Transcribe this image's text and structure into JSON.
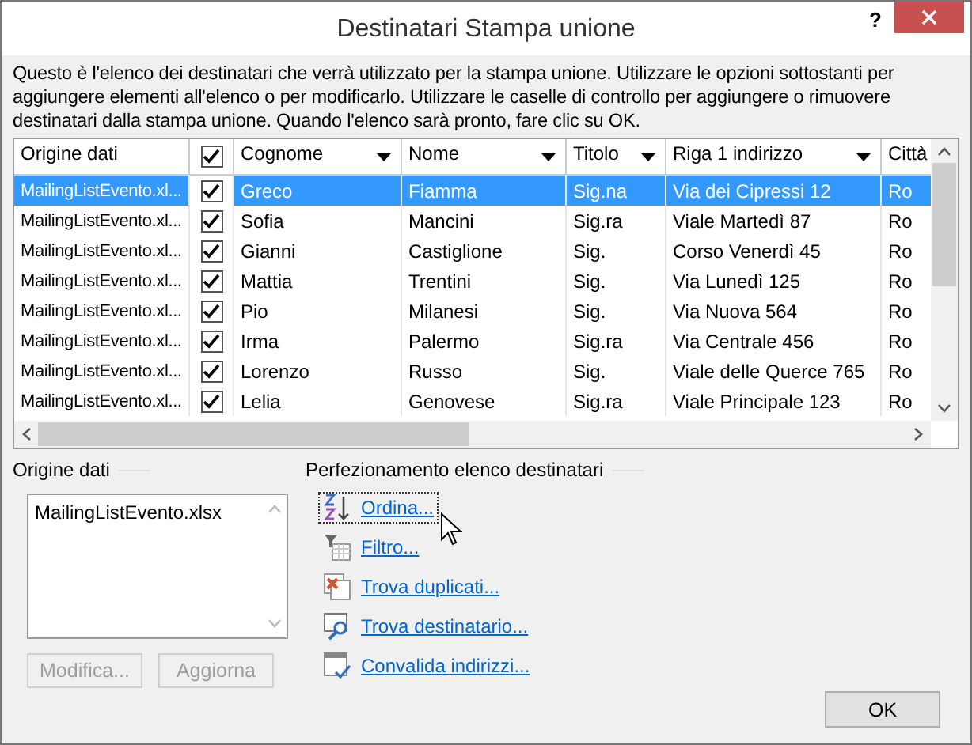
{
  "window": {
    "title": "Destinatari Stampa unione",
    "help": "?"
  },
  "description": "Questo è l'elenco dei destinatari che verrà utilizzato per la stampa unione. Utilizzare le opzioni sottostanti per aggiungere elementi all'elenco o per modificarlo. Utilizzare le caselle di controllo per aggiungere o rimuovere destinatari dalla stampa unione. Quando l'elenco sarà pronto, fare clic su OK.",
  "table": {
    "header_checked": true,
    "columns": [
      {
        "label": "Origine dati",
        "kind": "text"
      },
      {
        "label": "Cognome",
        "kind": "dropdown"
      },
      {
        "label": "Nome",
        "kind": "dropdown"
      },
      {
        "label": "Titolo",
        "kind": "dropdown"
      },
      {
        "label": "Riga 1 indirizzo",
        "kind": "dropdown"
      },
      {
        "label": "Città",
        "kind": "text"
      }
    ],
    "rows": [
      {
        "selected": true,
        "checked": true,
        "cells": [
          "MailingListEvento.xl...",
          "Greco",
          "Fiamma",
          "Sig.na",
          "Via dei Cipressi 12",
          "Ro"
        ]
      },
      {
        "selected": false,
        "checked": true,
        "cells": [
          "MailingListEvento.xl...",
          "Sofia",
          "Mancini",
          "Sig.ra",
          "Viale Martedì 87",
          "Ro"
        ]
      },
      {
        "selected": false,
        "checked": true,
        "cells": [
          "MailingListEvento.xl...",
          "Gianni",
          "Castiglione",
          "Sig.",
          "Corso Venerdì 45",
          "Ro"
        ]
      },
      {
        "selected": false,
        "checked": true,
        "cells": [
          "MailingListEvento.xl...",
          "Mattia",
          "Trentini",
          "Sig.",
          "Via Lunedì 125",
          "Ro"
        ]
      },
      {
        "selected": false,
        "checked": true,
        "cells": [
          "MailingListEvento.xl...",
          "Pio",
          "Milanesi",
          "Sig.",
          "Via Nuova 564",
          "Ro"
        ]
      },
      {
        "selected": false,
        "checked": true,
        "cells": [
          "MailingListEvento.xl...",
          "Irma",
          "Palermo",
          "Sig.ra",
          "Via Centrale 456",
          "Ro"
        ]
      },
      {
        "selected": false,
        "checked": true,
        "cells": [
          "MailingListEvento.xl...",
          "Lorenzo",
          "Russo",
          "Sig.",
          "Viale delle Querce 765",
          "Ro"
        ]
      },
      {
        "selected": false,
        "checked": true,
        "cells": [
          "MailingListEvento.xl...",
          "Lelia",
          "Genovese",
          "Sig.ra",
          "Viale Principale 123",
          "Ro"
        ]
      }
    ]
  },
  "data_source": {
    "label": "Origine dati",
    "items": [
      "MailingListEvento.xlsx"
    ],
    "buttons": [
      {
        "label": "Modifica...",
        "disabled": true
      },
      {
        "label": "Aggiorna",
        "disabled": true
      }
    ]
  },
  "refine": {
    "label": "Perfezionamento elenco destinatari",
    "links": [
      {
        "label": "Ordina...",
        "kind": "sort",
        "focused": true
      },
      {
        "label": "Filtro...",
        "kind": "filter",
        "focused": false
      },
      {
        "label": "Trova duplicati...",
        "kind": "duplicates",
        "focused": false
      },
      {
        "label": "Trova destinatario...",
        "kind": "find",
        "focused": false
      },
      {
        "label": "Convalida indirizzi...",
        "kind": "validate",
        "focused": false
      }
    ]
  },
  "ok_button": "OK"
}
